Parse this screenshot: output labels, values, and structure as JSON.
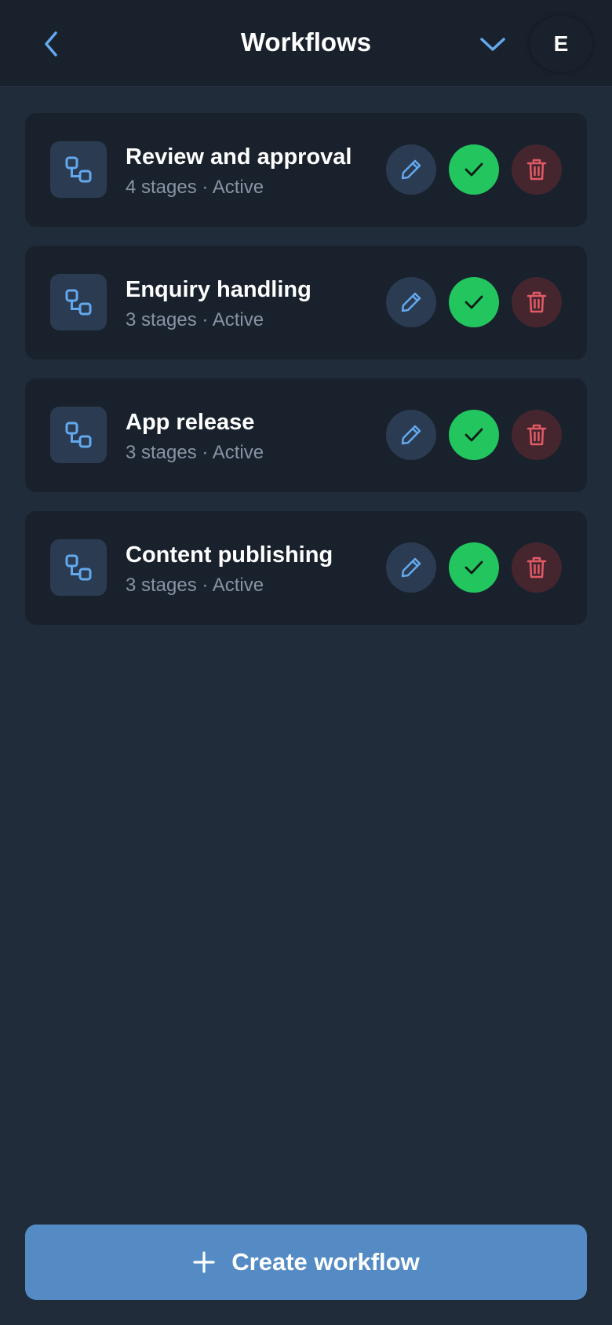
{
  "header": {
    "title": "Workflows",
    "back_icon": "chevron-left-icon",
    "dropdown_icon": "chevron-down-icon",
    "avatar_initial": "E"
  },
  "workflows": [
    {
      "name": "Review and approval",
      "stages": "4 stages",
      "separator": " · ",
      "status": "Active"
    },
    {
      "name": "Enquiry handling",
      "stages": "3 stages",
      "separator": " · ",
      "status": "Active"
    },
    {
      "name": "App release",
      "stages": "3 stages",
      "separator": " · ",
      "status": "Active"
    },
    {
      "name": "Content publishing",
      "stages": "3 stages",
      "separator": " · ",
      "status": "Active"
    }
  ],
  "row_icons": {
    "workflow": "workflow-icon",
    "edit": "pencil-icon",
    "approve": "check-icon",
    "delete": "trash-icon"
  },
  "footer": {
    "create_label": "Create workflow",
    "create_icon": "plus-icon"
  },
  "colors": {
    "background": "#212c3b",
    "header": "#19212c",
    "card": "#19212c",
    "accent_blue": "#63a9ef",
    "approve_green": "#22c55e",
    "delete_red": "#e05a66",
    "create_button": "#558bc4"
  }
}
